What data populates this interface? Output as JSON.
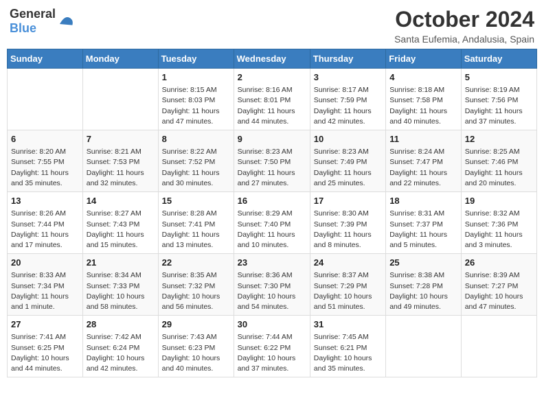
{
  "header": {
    "logo_general": "General",
    "logo_blue": "Blue",
    "month": "October 2024",
    "location": "Santa Eufemia, Andalusia, Spain"
  },
  "days_of_week": [
    "Sunday",
    "Monday",
    "Tuesday",
    "Wednesday",
    "Thursday",
    "Friday",
    "Saturday"
  ],
  "weeks": [
    [
      {
        "day": "",
        "info": ""
      },
      {
        "day": "",
        "info": ""
      },
      {
        "day": "1",
        "info": "Sunrise: 8:15 AM\nSunset: 8:03 PM\nDaylight: 11 hours and 47 minutes."
      },
      {
        "day": "2",
        "info": "Sunrise: 8:16 AM\nSunset: 8:01 PM\nDaylight: 11 hours and 44 minutes."
      },
      {
        "day": "3",
        "info": "Sunrise: 8:17 AM\nSunset: 7:59 PM\nDaylight: 11 hours and 42 minutes."
      },
      {
        "day": "4",
        "info": "Sunrise: 8:18 AM\nSunset: 7:58 PM\nDaylight: 11 hours and 40 minutes."
      },
      {
        "day": "5",
        "info": "Sunrise: 8:19 AM\nSunset: 7:56 PM\nDaylight: 11 hours and 37 minutes."
      }
    ],
    [
      {
        "day": "6",
        "info": "Sunrise: 8:20 AM\nSunset: 7:55 PM\nDaylight: 11 hours and 35 minutes."
      },
      {
        "day": "7",
        "info": "Sunrise: 8:21 AM\nSunset: 7:53 PM\nDaylight: 11 hours and 32 minutes."
      },
      {
        "day": "8",
        "info": "Sunrise: 8:22 AM\nSunset: 7:52 PM\nDaylight: 11 hours and 30 minutes."
      },
      {
        "day": "9",
        "info": "Sunrise: 8:23 AM\nSunset: 7:50 PM\nDaylight: 11 hours and 27 minutes."
      },
      {
        "day": "10",
        "info": "Sunrise: 8:23 AM\nSunset: 7:49 PM\nDaylight: 11 hours and 25 minutes."
      },
      {
        "day": "11",
        "info": "Sunrise: 8:24 AM\nSunset: 7:47 PM\nDaylight: 11 hours and 22 minutes."
      },
      {
        "day": "12",
        "info": "Sunrise: 8:25 AM\nSunset: 7:46 PM\nDaylight: 11 hours and 20 minutes."
      }
    ],
    [
      {
        "day": "13",
        "info": "Sunrise: 8:26 AM\nSunset: 7:44 PM\nDaylight: 11 hours and 17 minutes."
      },
      {
        "day": "14",
        "info": "Sunrise: 8:27 AM\nSunset: 7:43 PM\nDaylight: 11 hours and 15 minutes."
      },
      {
        "day": "15",
        "info": "Sunrise: 8:28 AM\nSunset: 7:41 PM\nDaylight: 11 hours and 13 minutes."
      },
      {
        "day": "16",
        "info": "Sunrise: 8:29 AM\nSunset: 7:40 PM\nDaylight: 11 hours and 10 minutes."
      },
      {
        "day": "17",
        "info": "Sunrise: 8:30 AM\nSunset: 7:39 PM\nDaylight: 11 hours and 8 minutes."
      },
      {
        "day": "18",
        "info": "Sunrise: 8:31 AM\nSunset: 7:37 PM\nDaylight: 11 hours and 5 minutes."
      },
      {
        "day": "19",
        "info": "Sunrise: 8:32 AM\nSunset: 7:36 PM\nDaylight: 11 hours and 3 minutes."
      }
    ],
    [
      {
        "day": "20",
        "info": "Sunrise: 8:33 AM\nSunset: 7:34 PM\nDaylight: 11 hours and 1 minute."
      },
      {
        "day": "21",
        "info": "Sunrise: 8:34 AM\nSunset: 7:33 PM\nDaylight: 10 hours and 58 minutes."
      },
      {
        "day": "22",
        "info": "Sunrise: 8:35 AM\nSunset: 7:32 PM\nDaylight: 10 hours and 56 minutes."
      },
      {
        "day": "23",
        "info": "Sunrise: 8:36 AM\nSunset: 7:30 PM\nDaylight: 10 hours and 54 minutes."
      },
      {
        "day": "24",
        "info": "Sunrise: 8:37 AM\nSunset: 7:29 PM\nDaylight: 10 hours and 51 minutes."
      },
      {
        "day": "25",
        "info": "Sunrise: 8:38 AM\nSunset: 7:28 PM\nDaylight: 10 hours and 49 minutes."
      },
      {
        "day": "26",
        "info": "Sunrise: 8:39 AM\nSunset: 7:27 PM\nDaylight: 10 hours and 47 minutes."
      }
    ],
    [
      {
        "day": "27",
        "info": "Sunrise: 7:41 AM\nSunset: 6:25 PM\nDaylight: 10 hours and 44 minutes."
      },
      {
        "day": "28",
        "info": "Sunrise: 7:42 AM\nSunset: 6:24 PM\nDaylight: 10 hours and 42 minutes."
      },
      {
        "day": "29",
        "info": "Sunrise: 7:43 AM\nSunset: 6:23 PM\nDaylight: 10 hours and 40 minutes."
      },
      {
        "day": "30",
        "info": "Sunrise: 7:44 AM\nSunset: 6:22 PM\nDaylight: 10 hours and 37 minutes."
      },
      {
        "day": "31",
        "info": "Sunrise: 7:45 AM\nSunset: 6:21 PM\nDaylight: 10 hours and 35 minutes."
      },
      {
        "day": "",
        "info": ""
      },
      {
        "day": "",
        "info": ""
      }
    ]
  ]
}
